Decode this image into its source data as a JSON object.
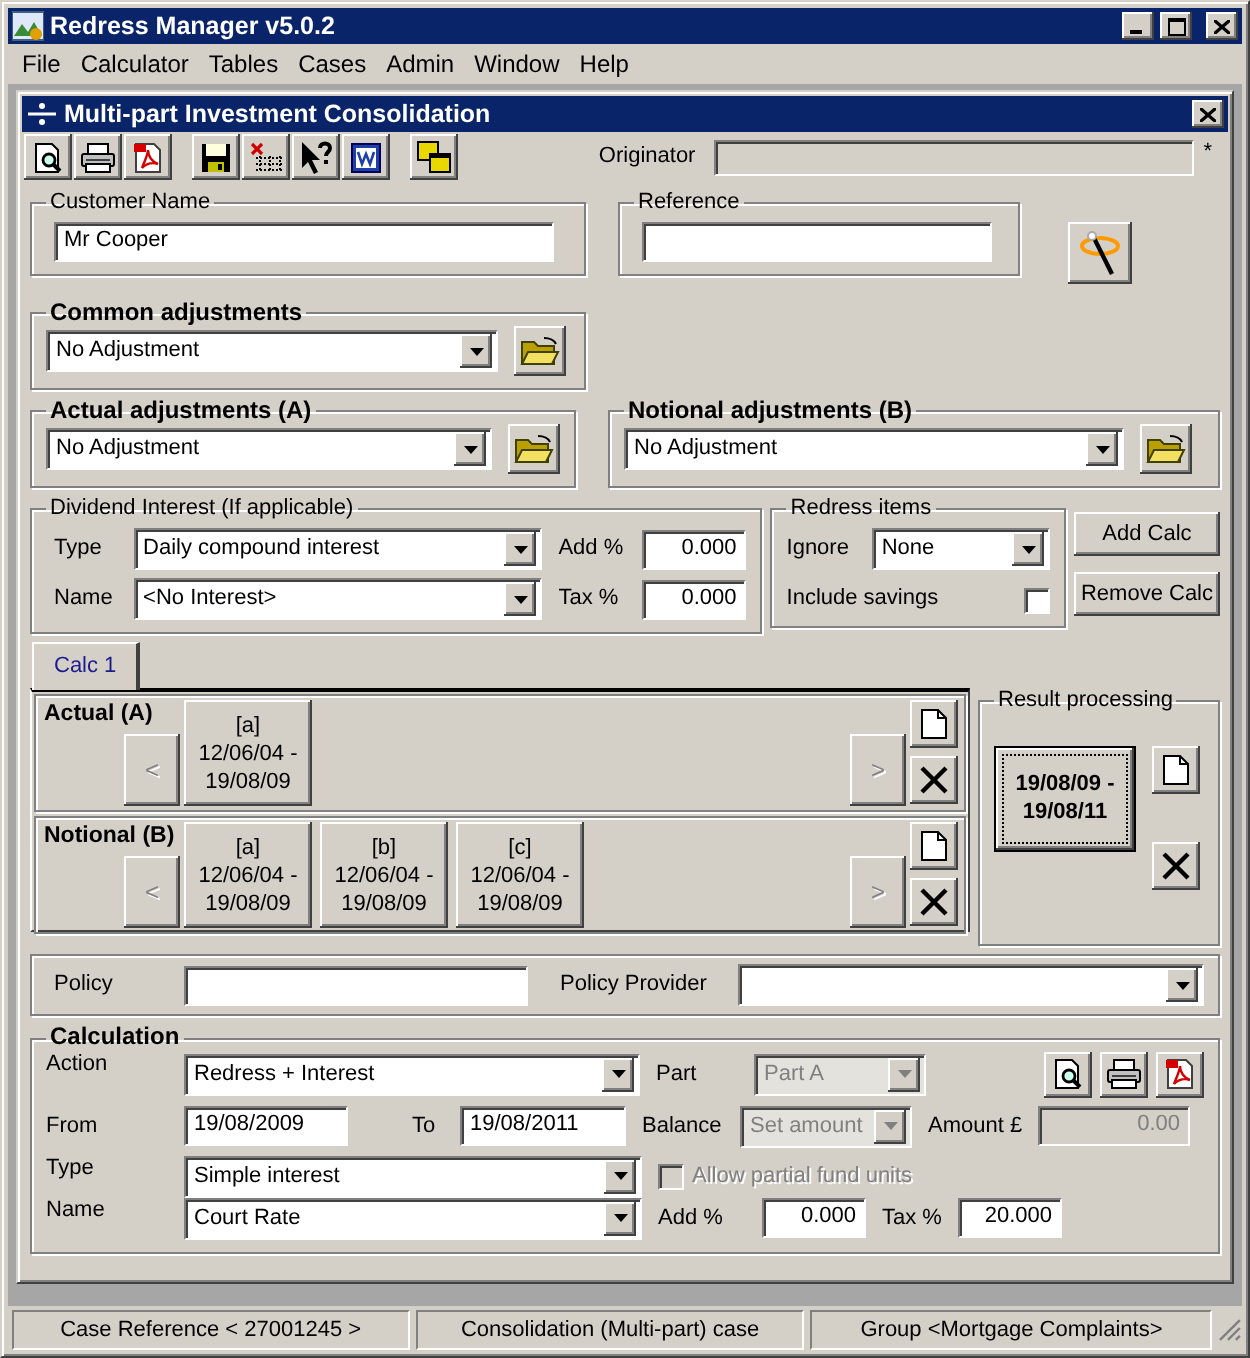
{
  "app_window": {
    "title": "Redress Manager v5.0.2"
  },
  "menu": [
    "File",
    "Calculator",
    "Tables",
    "Cases",
    "Admin",
    "Window",
    "Help"
  ],
  "child_window": {
    "title": "Multi-part Investment Consolidation"
  },
  "toolbar": {
    "originator_label": "Originator",
    "required_mark": "*"
  },
  "customer_name": {
    "label": "Customer Name",
    "value": "Mr Cooper"
  },
  "reference": {
    "label": "Reference"
  },
  "common_adjustments": {
    "label": "Common adjustments",
    "value": "No Adjustment"
  },
  "actual_adjustments": {
    "label": "Actual adjustments (A)",
    "value": "No Adjustment"
  },
  "notional_adjustments": {
    "label": "Notional adjustments (B)",
    "value": "No Adjustment"
  },
  "dividend_interest": {
    "label": "Dividend Interest (If applicable)",
    "type_label": "Type",
    "type_value": "Daily compound interest",
    "add_label": "Add %",
    "add_value": "0.000",
    "name_label": "Name",
    "name_value": "<No Interest>",
    "tax_label": "Tax %",
    "tax_value": "0.000"
  },
  "redress_items": {
    "label": "Redress items",
    "ignore_label": "Ignore",
    "ignore_value": "None",
    "include_savings_label": "Include savings",
    "include_savings_checked": false
  },
  "calc_buttons": [
    "Add Calc",
    "Remove Calc"
  ],
  "tabs": [
    {
      "label": "Calc 1",
      "selected": true
    }
  ],
  "sections": [
    {
      "label": "Actual (A)",
      "prev": "<",
      "prev_disabled": true,
      "next": ">",
      "next_disabled": true,
      "periods": [
        {
          "lines": [
            "[a]",
            "12/06/04 -",
            "19/08/09"
          ],
          "selected": false
        }
      ]
    },
    {
      "label": "Notional (B)",
      "prev": "<",
      "prev_disabled": true,
      "next": ">",
      "next_disabled": true,
      "periods": [
        {
          "lines": [
            "[a]",
            "12/06/04 -",
            "19/08/09"
          ],
          "selected": false
        },
        {
          "lines": [
            "[b]",
            "12/06/04 -",
            "19/08/09"
          ],
          "selected": false
        },
        {
          "lines": [
            "[c]",
            "12/06/04 -",
            "19/08/09"
          ],
          "selected": false
        }
      ]
    }
  ],
  "result_processing": {
    "label": "Result processing",
    "results": [
      {
        "lines": [
          "19/08/09 -",
          "19/08/11"
        ],
        "selected": true
      }
    ]
  },
  "policy": {
    "policy_label": "Policy",
    "provider_label": "Policy Provider"
  },
  "calculation": {
    "label": "Calculation",
    "action_label": "Action",
    "action_value": "Redress + Interest",
    "part_label": "Part",
    "part_value": "Part A",
    "part_disabled": true,
    "from_label": "From",
    "from_value": "19/08/2009",
    "to_label": "To",
    "to_value": "19/08/2011",
    "balance_label": "Balance",
    "balance_value": "Set amount",
    "balance_disabled": true,
    "amount_label": "Amount £",
    "amount_value": "0.00",
    "amount_disabled": true,
    "type_label": "Type",
    "type_value": "Simple interest",
    "partial_units": {
      "label": "Allow partial fund units",
      "checked": false,
      "disabled": true
    },
    "name_label": "Name",
    "name_value": "Court Rate",
    "add_label": "Add %",
    "add_value": "0.000",
    "tax_label": "Tax %",
    "tax_value": "20.000"
  },
  "status_bar": [
    "Case Reference < 27001245 >",
    "Consolidation (Multi-part) case",
    "Group <Mortgage Complaints>"
  ]
}
